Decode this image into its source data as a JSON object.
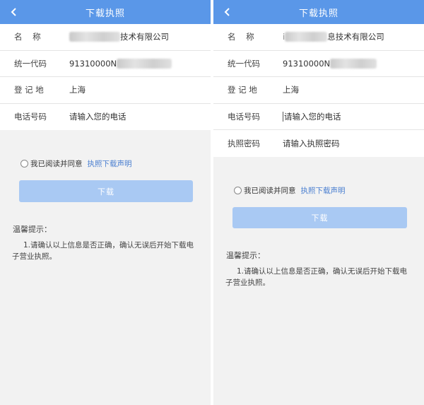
{
  "left": {
    "header": {
      "title": "下载执照"
    },
    "fields": [
      {
        "label": "名    称",
        "value": "技术有限公司"
      },
      {
        "label": "统一代码",
        "value": "91310000N"
      },
      {
        "label": "登 记 地",
        "value": "上海"
      },
      {
        "label": "电话号码",
        "placeholder": "请输入您的电话"
      }
    ],
    "agreement": {
      "text": "我已阅读并同意",
      "link": "执照下载声明"
    },
    "download_button": "下载",
    "tips": {
      "title": "温馨提示：",
      "body": "1.请确认以上信息是否正确，确认无误后开始下载电子营业执照。"
    }
  },
  "right": {
    "header": {
      "title": "下载执照"
    },
    "fields": [
      {
        "label": "名    称",
        "value_prefix": "i",
        "value": "息技术有限公司"
      },
      {
        "label": "统一代码",
        "value": "91310000N"
      },
      {
        "label": "登 记 地",
        "value": "上海"
      },
      {
        "label": "电话号码",
        "placeholder": "请输入您的电话"
      },
      {
        "label": "执照密码",
        "placeholder": "请输入执照密码"
      }
    ],
    "agreement": {
      "text": "我已阅读并同意",
      "link": "执照下载声明"
    },
    "download_button": "下载",
    "tips": {
      "title": "温馨提示：",
      "body": "1.请确认以上信息是否正确，确认无误后开始下载电子营业执照。"
    }
  },
  "colors": {
    "header": "#5a97e8",
    "button": "#a9c9f3",
    "link": "#4a7fd0",
    "background": "#f2f2f2"
  }
}
